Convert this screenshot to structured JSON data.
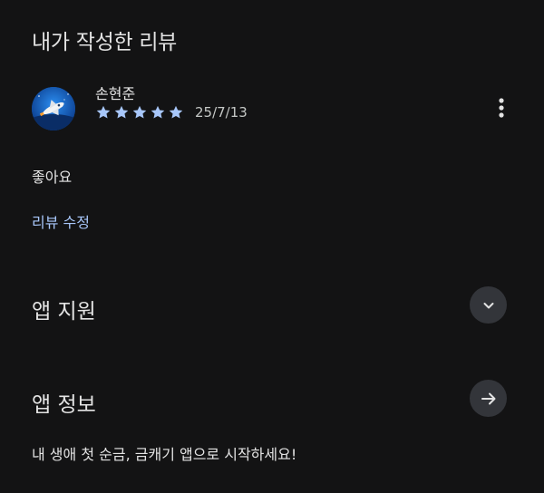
{
  "my_review": {
    "title": "내가 작성한 리뷰",
    "reviewer": "손현준",
    "rating": 5,
    "max_rating": 5,
    "date": "25/7/13",
    "text": "좋아요",
    "edit_label": "리뷰 수정",
    "avatar_icon": "space-shuttle-icon",
    "more_icon": "more-vert-icon"
  },
  "app_support": {
    "title": "앱 지원",
    "icon": "chevron-down-icon"
  },
  "app_info": {
    "title": "앱 정보",
    "icon": "arrow-right-icon",
    "description": "내 생애 첫 순금, 금캐기 앱으로 시작하세요!"
  },
  "colors": {
    "background": "#131314",
    "text": "#e3e3e3",
    "link": "#a8c7fa",
    "star": "#a8c7fa",
    "button_bg": "#33353a"
  }
}
